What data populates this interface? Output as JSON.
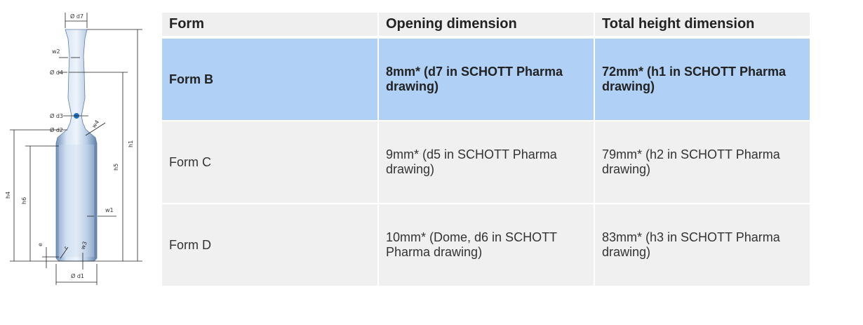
{
  "drawing": {
    "labels": {
      "d7": "Ø d7",
      "w2": "w2",
      "d4": "Ø d4",
      "d3": "Ø d3",
      "d2": "Ø d2",
      "w4": "w4",
      "h1": "h1",
      "h5": "h5",
      "h4": "h4",
      "h6": "h6",
      "w1": "w1",
      "e": "e",
      "r": "r",
      "w3": "w3",
      "d1": "Ø d1"
    },
    "colors": {
      "glass": "#9fb8d8",
      "dot": "#1e6fc0"
    }
  },
  "table": {
    "headers": [
      "Form",
      "Opening dimension",
      "Total height dimension"
    ],
    "rows": [
      {
        "form": "Form B",
        "opening": "8mm* (d7 in SCHOTT Pharma drawing)",
        "height": "72mm* (h1 in SCHOTT Pharma drawing)",
        "highlight": true
      },
      {
        "form": "Form C",
        "opening": "9mm* (d5 in SCHOTT Pharma drawing)",
        "height": "79mm* (h2 in SCHOTT Pharma drawing)",
        "highlight": false
      },
      {
        "form": "Form D",
        "opening": "10mm* (Dome, d6 in SCHOTT Pharma drawing)",
        "height": "83mm* (h3 in SCHOTT Pharma drawing)",
        "highlight": false
      }
    ]
  }
}
